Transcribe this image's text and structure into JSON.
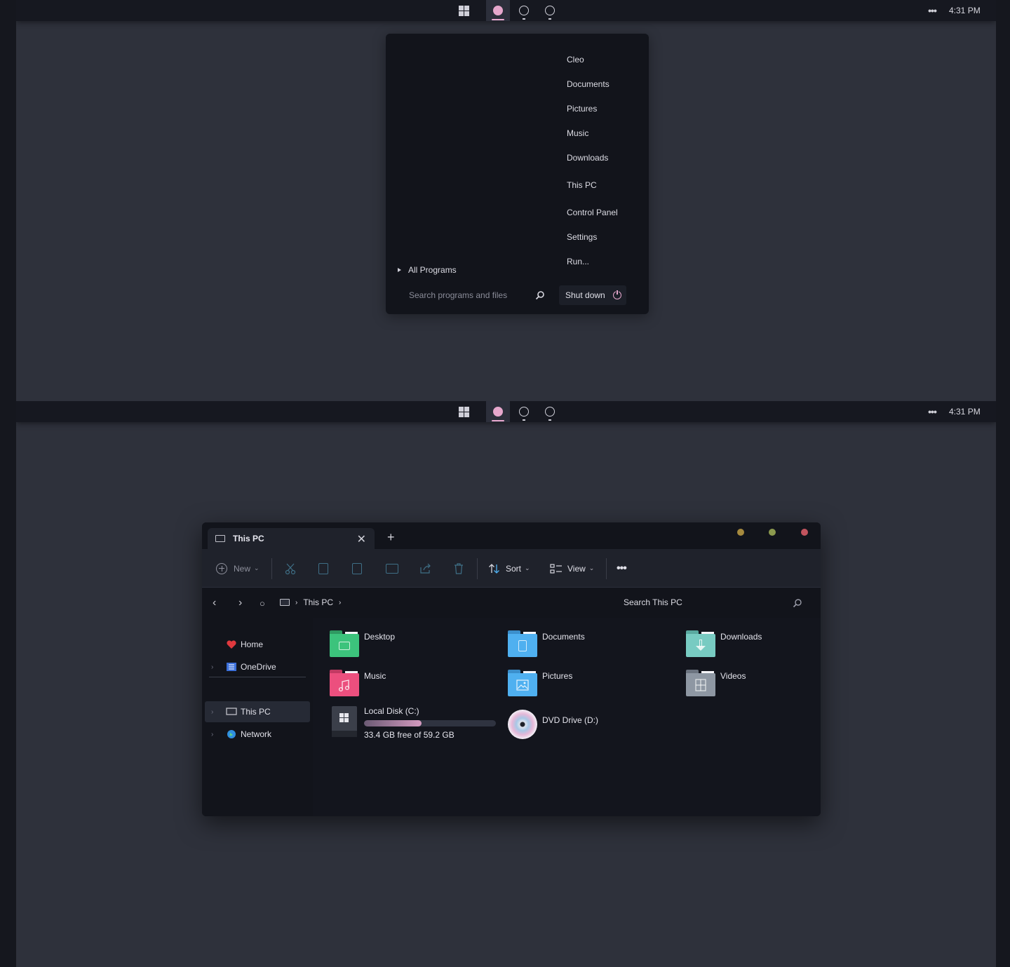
{
  "taskbar": {
    "clock": "4:31 PM",
    "overflow_icon": "ellipsis-icon",
    "accent": "#e6a7cc"
  },
  "start_menu": {
    "places": [
      "Cleo",
      "Documents",
      "Pictures",
      "Music",
      "Downloads",
      "This PC",
      "Control Panel",
      "Settings",
      "Run..."
    ],
    "all_programs": "All Programs",
    "search_placeholder": "Search programs and files",
    "shutdown_label": "Shut down"
  },
  "explorer": {
    "tab_title": "This PC",
    "toolbar": {
      "new_label": "New",
      "sort_label": "Sort",
      "view_label": "View"
    },
    "breadcrumb": "This PC",
    "search_placeholder": "Search This PC",
    "nav": {
      "home": "Home",
      "onedrive": "OneDrive",
      "thispc": "This PC",
      "network": "Network"
    },
    "folders": [
      {
        "name": "Desktop",
        "color": "#3cc37c"
      },
      {
        "name": "Documents",
        "color": "#4fb0f0"
      },
      {
        "name": "Downloads",
        "color": "#78cbc2"
      },
      {
        "name": "Music",
        "color": "#ec4f7e"
      },
      {
        "name": "Pictures",
        "color": "#4fb0f0"
      },
      {
        "name": "Videos",
        "color": "#8e97a3"
      }
    ],
    "drives": {
      "c_name": "Local Disk (C:)",
      "c_space": "33.4 GB free of 59.2 GB",
      "c_used_fraction": 0.436,
      "d_name": "DVD Drive (D:)"
    },
    "window_dots": [
      "#a68a3e",
      "#8c9a4e",
      "#c2545e"
    ]
  }
}
